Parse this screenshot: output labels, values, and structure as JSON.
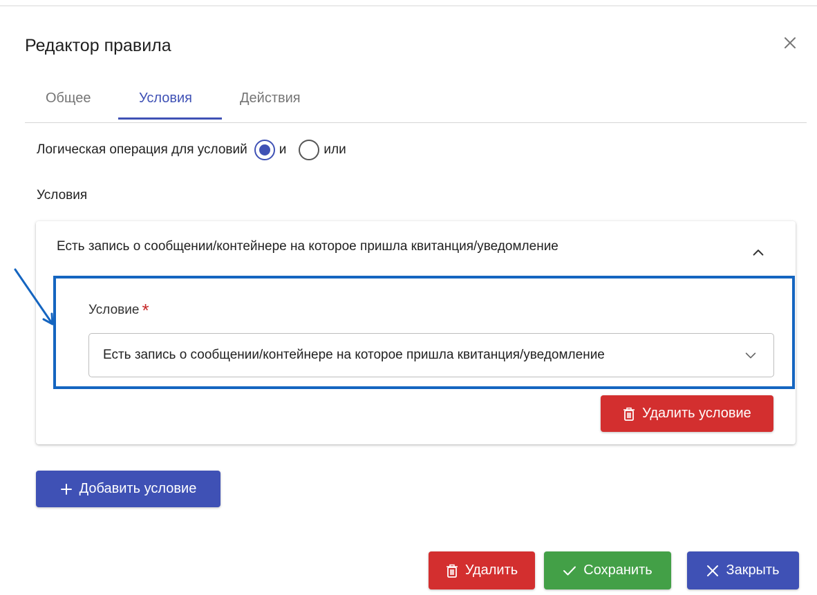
{
  "dialog": {
    "title": "Редактор правила",
    "close_icon": "close-icon"
  },
  "tabs": [
    {
      "label": "Общее",
      "active": false
    },
    {
      "label": "Условия",
      "active": true
    },
    {
      "label": "Действия",
      "active": false
    }
  ],
  "logic": {
    "label": "Логическая операция для условий",
    "options": [
      {
        "label": "и",
        "selected": true
      },
      {
        "label": "или",
        "selected": false
      }
    ]
  },
  "conditions_section": {
    "label": "Условия"
  },
  "condition_card": {
    "header": "Есть запись о сообщении/контейнере на которое пришла квитанция/уведомление",
    "expanded": true,
    "field_label": "Условие",
    "required_mark": "*",
    "select_value": "Есть запись о сообщении/контейнере на которое пришла квитанция/уведомление",
    "delete_button": "Удалить условие"
  },
  "add_button": "Добавить условие",
  "footer": {
    "delete": "Удалить",
    "save": "Сохранить",
    "close": "Закрыть"
  },
  "colors": {
    "primary": "#3f51b5",
    "danger": "#d32f2f",
    "success": "#43a047",
    "highlight": "#1565c0"
  }
}
